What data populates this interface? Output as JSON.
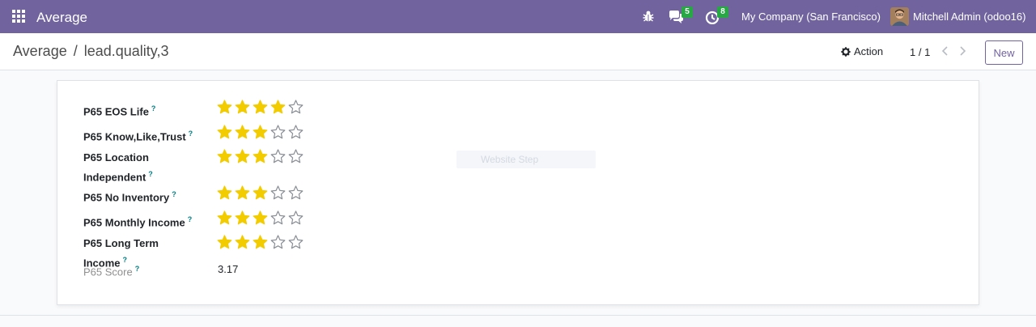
{
  "navbar": {
    "app_title": "Average",
    "chat_count": "5",
    "activity_count": "8",
    "company": "My Company (San Francisco)",
    "user": "Mitchell Admin (odoo16)",
    "color": "#71639e"
  },
  "control_panel": {
    "breadcrumb_parent": "Average",
    "breadcrumb_sep": "/",
    "breadcrumb_current": "lead.quality,3",
    "action_label": "Action",
    "pager": "1 / 1",
    "new_label": "New"
  },
  "form": {
    "fields": [
      {
        "label": "P65 EOS Life",
        "help": "?",
        "stars": 4,
        "max": 5
      },
      {
        "label": "P65 Know,Like,Trust",
        "help": "?",
        "stars": 3,
        "max": 5
      },
      {
        "label_line1": "P65 Location",
        "label_line2": "Independent",
        "help": "?",
        "stars": 3,
        "max": 5
      },
      {
        "label": "P65 No Inventory",
        "help": "?",
        "stars": 3,
        "max": 5
      },
      {
        "label": "P65 Monthly Income",
        "help": "?",
        "stars": 3,
        "max": 5
      },
      {
        "label": "P65 Long Term Income",
        "help": "?",
        "stars": 3,
        "max": 5
      }
    ],
    "score": {
      "label": "P65 Score",
      "help": "?",
      "value": "3.17"
    },
    "ghost_text": "Website Step",
    "star_color": "#f3cc00"
  }
}
